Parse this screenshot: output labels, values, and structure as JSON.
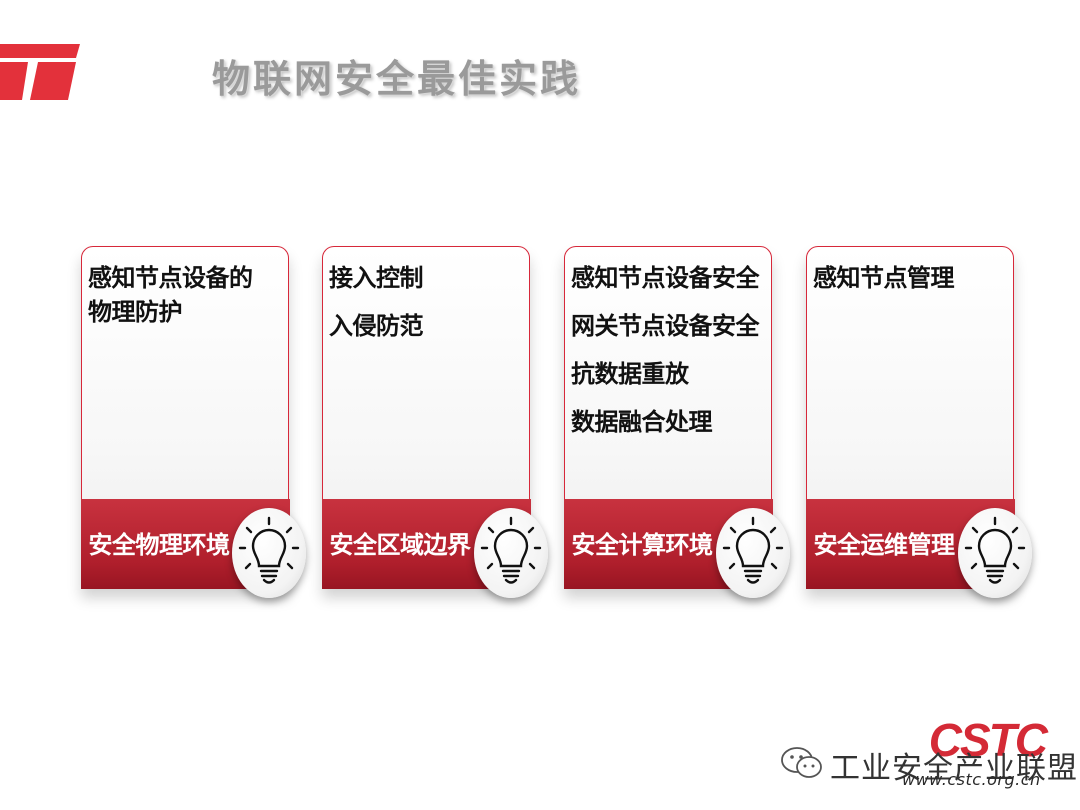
{
  "header": {
    "title": "物联网安全最佳实践"
  },
  "cards": [
    {
      "items": [
        "感知节点设备的物理防护"
      ],
      "footer": "安全物理环境"
    },
    {
      "items": [
        "接入控制",
        "入侵防范"
      ],
      "footer": "安全区域边界"
    },
    {
      "items": [
        "感知节点设备安全",
        "网关节点设备安全",
        "抗数据重放",
        "数据融合处理"
      ],
      "footer": "安全计算环境"
    },
    {
      "items": [
        "感知节点管理"
      ],
      "footer": "安全运维管理"
    }
  ],
  "branding": {
    "logo_text": "CSTC",
    "watermark": "工业安全产业联盟",
    "website": "www.cstc.org.cn",
    "accent_color": "#c0232f"
  },
  "icons": {
    "card_icon": "lightbulb-icon",
    "corner_logo": "t-logo-icon",
    "watermark_icon": "wechat-icon"
  }
}
